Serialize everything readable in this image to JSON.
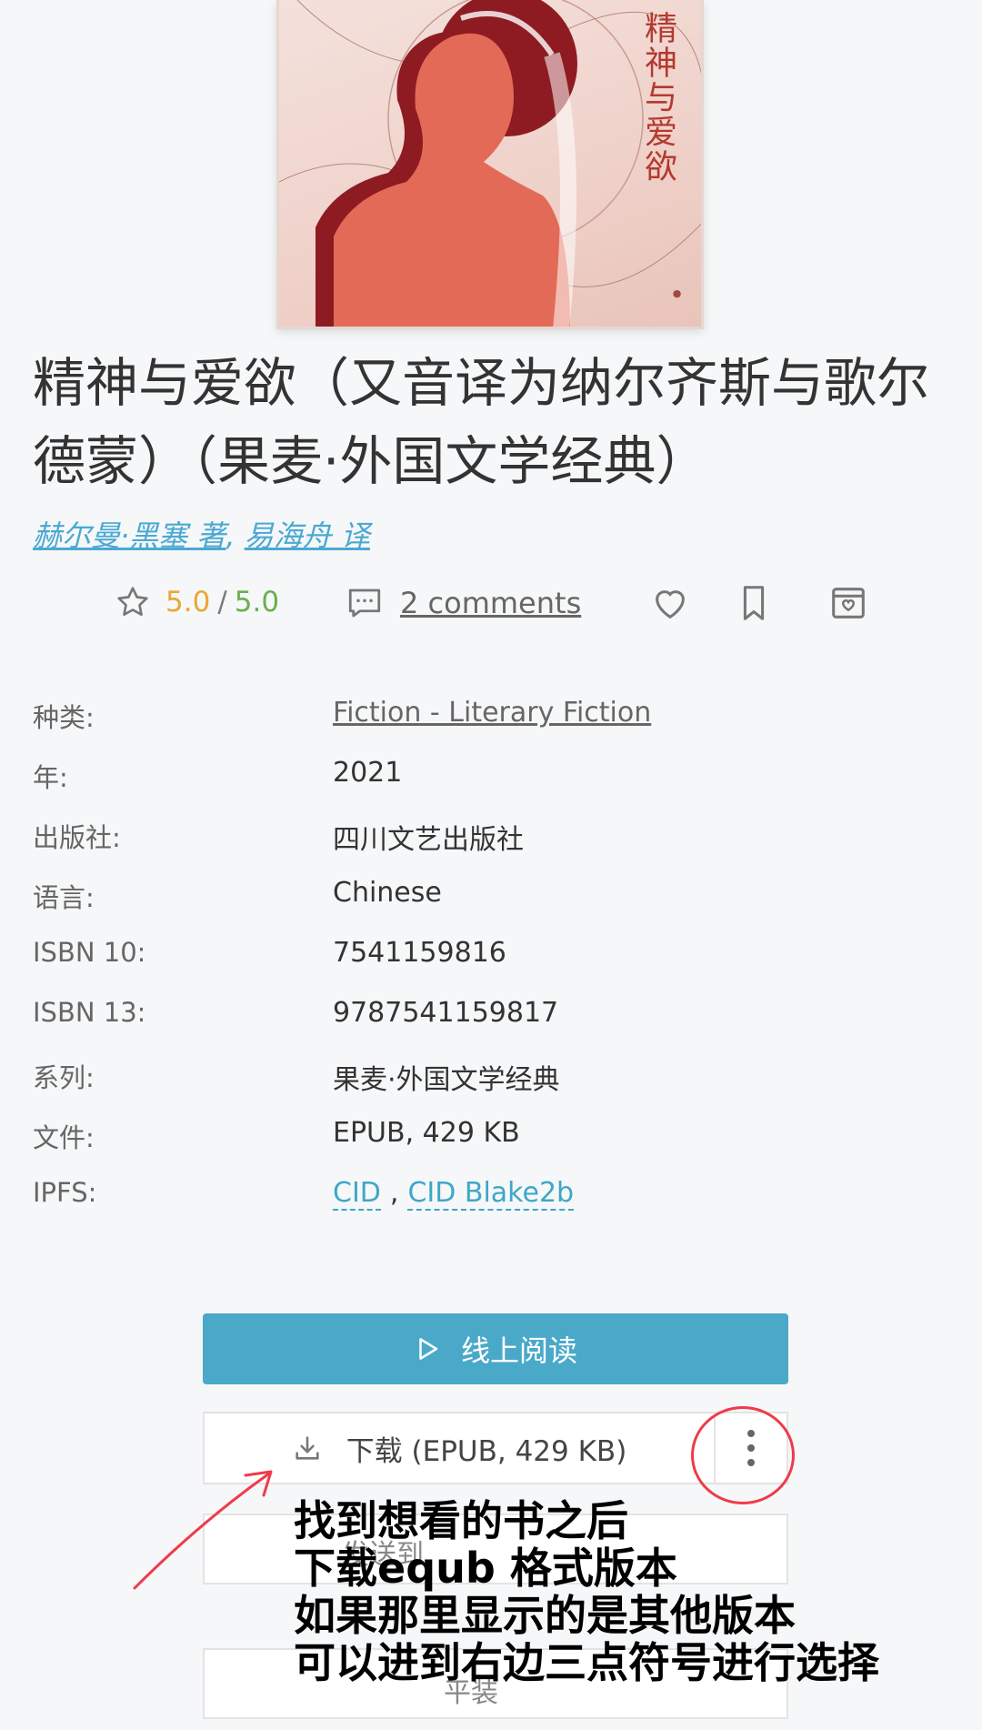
{
  "cover": {
    "title_vertical": "精神与爱欲"
  },
  "book": {
    "title": "精神与爱欲（又音译为纳尔齐斯与歌尔德蒙）（果麦·外国文学经典）",
    "author_1": "赫尔曼·黑塞 著",
    "author_sep": ", ",
    "author_2": "易海舟 译"
  },
  "rating": {
    "score": "5.0",
    "sep": "/",
    "max": "5.0",
    "comments": "2 comments"
  },
  "details": {
    "category_label": "种类:",
    "category_value": "Fiction - Literary Fiction",
    "year_label": "年:",
    "year_value": "2021",
    "publisher_label": "出版社:",
    "publisher_value": "四川文艺出版社",
    "language_label": "语言:",
    "language_value": "Chinese",
    "isbn10_label": "ISBN 10:",
    "isbn10_value": "7541159816",
    "isbn13_label": "ISBN 13:",
    "isbn13_value": "9787541159817",
    "series_label": "系列:",
    "series_value": "果麦·外国文学经典",
    "file_label": "文件:",
    "file_value": "EPUB, 429 KB",
    "ipfs_label": "IPFS:",
    "ipfs_cid": "CID",
    "ipfs_sep": ",",
    "ipfs_blake": "CID Blake2b"
  },
  "buttons": {
    "read_online": "线上阅读",
    "download": "下载 (EPUB, 429 KB)",
    "partial_send": "发送到",
    "partial_bottom": "平装"
  },
  "annotation": {
    "line1": "找到想看的书之后",
    "line2": "下载equb 格式版本",
    "line3": "如果那里显示的是其他版本",
    "line4": "可以进到右边三点符号进行选择",
    "color": "#ef3b4a"
  },
  "colors": {
    "accent": "#4aa9c9",
    "link": "#4aa9d2",
    "rating": "#e8a833",
    "rating_max": "#6ab04c"
  }
}
